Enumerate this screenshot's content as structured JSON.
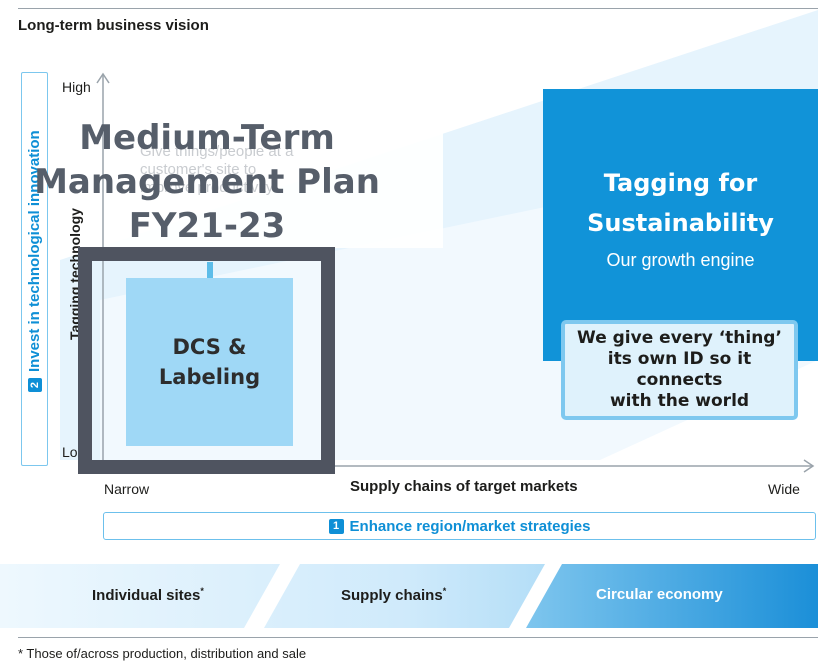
{
  "header": {
    "title": "Long-term business vision"
  },
  "axes": {
    "y_high": "High",
    "y_low": "Lo",
    "y_label": "Tagging technology",
    "x_narrow": "Narrow",
    "x_wide": "Wide",
    "x_label": "Supply chains of target markets"
  },
  "strategy_2": {
    "number": "2",
    "label": "Invest in technological innovation"
  },
  "strategy_1": {
    "number": "1",
    "label": "Enhance region/market strategies"
  },
  "ghost_text": "Give things/people at a customer's site to improve productivity",
  "overlay": {
    "line1": "Medium-Term",
    "line2": "Management Plan",
    "line3": "FY21-23"
  },
  "dcs": {
    "line1": "DCS &",
    "line2": "Labeling"
  },
  "tagging": {
    "line1": "Tagging for",
    "line2": "Sustainability",
    "subtitle": "Our growth engine"
  },
  "we_give": {
    "line1": "We give every ‘thing’",
    "line2": "its own ID so it connects",
    "line3": "with the world"
  },
  "bands": {
    "b1": "Individual sites",
    "b2": "Supply chains",
    "b3": "Circular economy",
    "mark": "*"
  },
  "footnote": "* Those of/across production, distribution and sale",
  "colors": {
    "accent": "#1193d8",
    "light_blue": "#9fd8f6",
    "dark_frame": "#4f5460",
    "overlay_text": "#565e6a"
  }
}
